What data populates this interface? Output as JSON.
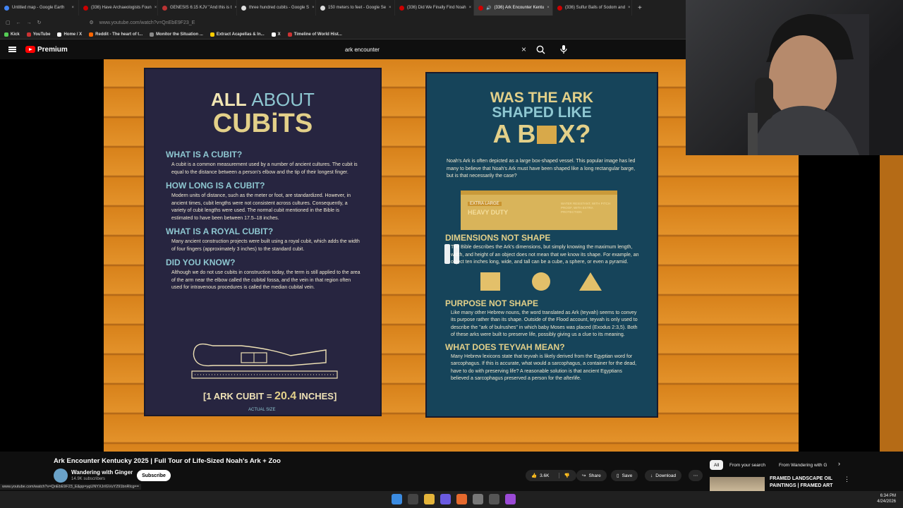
{
  "browser": {
    "tabs": [
      {
        "label": "Untitled map - Google Earth"
      },
      {
        "label": "(336) Have Archaeologists Foun"
      },
      {
        "label": "GENESIS 6:15 KJV \"And this is t"
      },
      {
        "label": "three hundred cubits - Google S"
      },
      {
        "label": "150 meters to feet - Google Se"
      },
      {
        "label": "(336) Did We Finally Find Noah"
      },
      {
        "label": "(336) Ark Encounter Kentu"
      },
      {
        "label": "(336) Sulfur Balls of Sodom and"
      }
    ],
    "url": "www.youtube.com/watch?v=QnEbE9F23_E",
    "bookmarks": [
      "Kick",
      "YouTube",
      "Home / X",
      "Reddit - The heart of t...",
      "Monitor the Situation ...",
      "Extract Acapellas & In...",
      "X",
      "Timeline of World Hist..."
    ]
  },
  "youtube": {
    "brand": "Premium",
    "search_query": "ark encounter"
  },
  "sign_left": {
    "title_a": "ALL",
    "title_b": "ABOUT",
    "title_c": "CUBiTS",
    "sections": [
      {
        "heading": "WHAT IS A CUBIT?",
        "text": "A cubit is a common measurement used by a number of ancient cultures. The cubit is equal to the distance between a person's elbow and the tip of their longest finger."
      },
      {
        "heading": "HOW LONG IS A CUBIT?",
        "text": "Modern units of distance, such as the meter or foot, are standardized. However, in ancient times, cubit lengths were not consistent across cultures. Consequently, a variety of cubit lengths were used. The normal cubit mentioned in the Bible is estimated to have been between 17.5–18 inches."
      },
      {
        "heading": "WHAT IS A ROYAL CUBIT?",
        "text": "Many ancient construction projects were built using a royal cubit, which adds the width of four fingers (approximately 3 inches) to the standard cubit."
      },
      {
        "heading": "DID YOU KNOW?",
        "text": "Although we do not use cubits in construction today, the term is still applied to the area of the arm near the elbow called the cubital fossa, and the vein in that region often used for intravenous procedures is called the median cubital vein."
      }
    ],
    "measure_a": "1 ARK CUBIT",
    "measure_eq": "=",
    "measure_b": "20.4",
    "measure_unit": "INCHES",
    "actual_size": "ACTUAL SIZE"
  },
  "sign_right": {
    "title_1": "WAS THE ARK",
    "title_2": "SHAPED LIKE",
    "title_3a": "A B",
    "title_3b": "X?",
    "intro": "Noah's Ark is often depicted as a large box-shaped vessel. This popular image has led many to believe that Noah's Ark must have been shaped like a long rectangular barge, but is that necessarily the case?",
    "box_label_1": "EXTRA LARGE",
    "box_label_2": "HEAVY DUTY",
    "box_side": "WATER RESISTANT, WITH PITCH PROOF, WITH EXTRA PROTECTION",
    "sections": [
      {
        "heading": "DIMENSIONS NOT SHAPE",
        "text": "The Bible describes the Ark's dimensions, but simply knowing the maximum length, width, and height of an object does not mean that we know its shape. For example, an object ten inches long, wide, and tall can be a cube, a sphere, or even a pyramid."
      },
      {
        "heading": "PURPOSE NOT SHAPE",
        "text": "Like many other Hebrew nouns, the word translated as Ark (teyvah) seems to convey its purpose rather than its shape. Outside of the Flood account, teyvah is only used to describe the \"ark of bulrushes\" in which baby Moses was placed (Exodus 2:3,5). Both of these arks were built to preserve life, possibly giving us a clue to its meaning."
      },
      {
        "heading": "WHAT DOES TEYVAH MEAN?",
        "text": "Many Hebrew lexicons state that teyvah is likely derived from the Egyptian word for sarcophagus. If this is accurate, what would a sarcophagus, a container for the dead, have to do with preserving life? A reasonable solution is that ancient Egyptians believed a sarcophagus preserved a person for the afterlife."
      }
    ]
  },
  "video_meta": {
    "title": "Ark Encounter Kentucky 2025 | Full Tour of Life-Sized Noah's Ark + Zoo",
    "channel": "Wandering with Ginger",
    "subscribers": "14.9K subscribers",
    "subscribe": "Subscribe",
    "likes": "3.6K",
    "share": "Share",
    "save": "Save",
    "download": "Download"
  },
  "sidebar": {
    "chips": [
      "All",
      "From your search",
      "From Wandering with G"
    ],
    "rec_title_1": "FRAMED LANDSCAPE OIL",
    "rec_title_2": "PAINTINGS | FRAMED ART"
  },
  "status_url": "www.youtube.com/watch?v=QnEbE9F23_E&pp=ygUNYXJrIGVuY291bnRlcg==",
  "clock": {
    "time": "6:34 PM",
    "date": "4/24/2026"
  }
}
